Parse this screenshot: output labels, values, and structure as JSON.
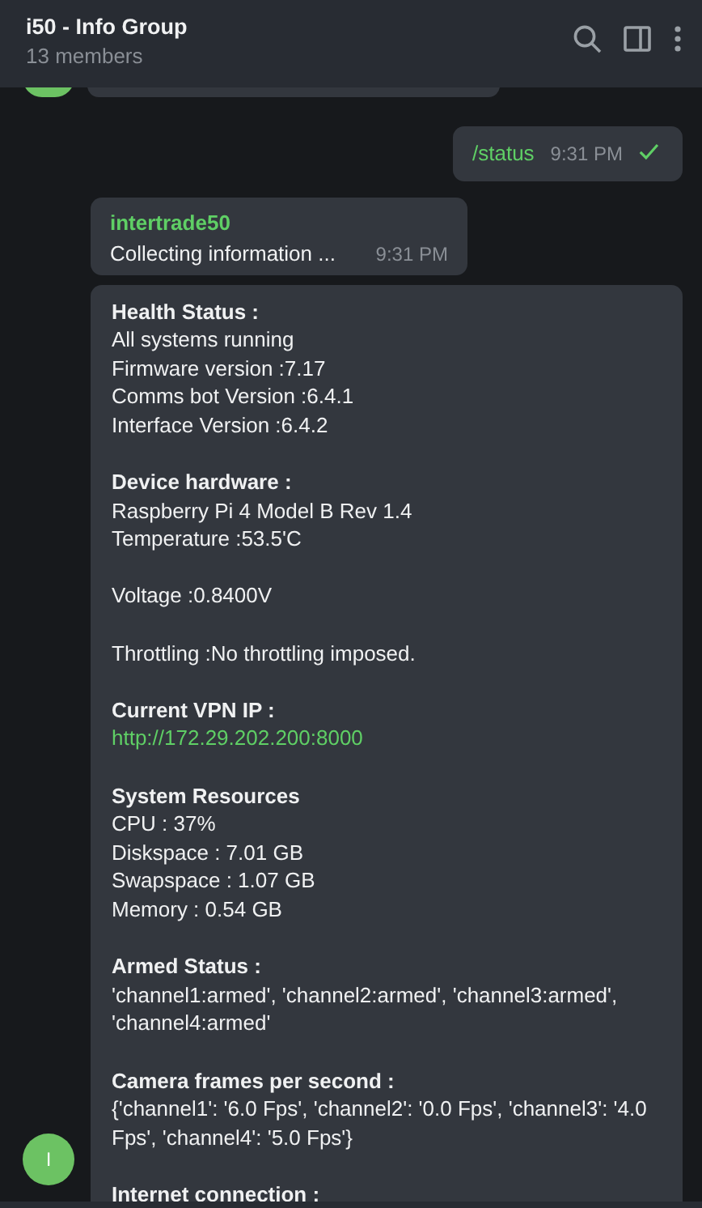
{
  "header": {
    "title": "i50 - Info Group",
    "subtitle": "13 members"
  },
  "messages": [
    {
      "kind": "partial"
    },
    {
      "kind": "outgoing",
      "text": "/status",
      "time": "9:31 PM",
      "sent": true
    },
    {
      "kind": "incoming",
      "sender": "intertrade50",
      "text": "Collecting information ...",
      "time": "9:31 PM"
    },
    {
      "kind": "report",
      "avatar": "I",
      "sections": [
        {
          "title": "Health Status :",
          "lines": [
            {
              "kind": "text",
              "text": "All systems running"
            },
            {
              "kind": "text",
              "text": "Firmware version :7.17"
            },
            {
              "kind": "text",
              "text": "Comms bot Version :6.4.1"
            },
            {
              "kind": "text",
              "text": "Interface Version :6.4.2"
            }
          ]
        },
        {
          "title": "Device hardware :",
          "lines": [
            {
              "kind": "text",
              "text": "Raspberry Pi 4 Model B Rev 1.4"
            },
            {
              "kind": "text",
              "text": "Temperature :53.5'C"
            }
          ]
        },
        {
          "lines": [
            {
              "kind": "text",
              "text": "Voltage :0.8400V"
            }
          ]
        },
        {
          "lines": [
            {
              "kind": "text",
              "text": "Throttling :No throttling imposed."
            }
          ]
        },
        {
          "title": "Current VPN IP :",
          "lines": [
            {
              "kind": "link",
              "text": "http://172.29.202.200:8000"
            }
          ]
        },
        {
          "title": "System Resources",
          "lines": [
            {
              "kind": "text",
              "text": "CPU : 37%"
            },
            {
              "kind": "text",
              "text": "Diskspace : 7.01 GB"
            },
            {
              "kind": "text",
              "text": "Swapspace : 1.07 GB"
            },
            {
              "kind": "text",
              "text": "Memory : 0.54 GB"
            }
          ]
        },
        {
          "title": "Armed Status :",
          "lines": [
            {
              "kind": "text",
              "text": "'channel1:armed', 'channel2:armed', 'channel3:armed', 'channel4:armed'"
            }
          ]
        },
        {
          "title": "Camera frames per second :",
          "lines": [
            {
              "kind": "text",
              "text": "{'channel1': '6.0 Fps', 'channel2': '0.0 Fps', 'channel3': '4.0 Fps', 'channel4': '5.0 Fps'}"
            }
          ]
        },
        {
          "title": "Internet connection :"
        }
      ]
    }
  ]
}
